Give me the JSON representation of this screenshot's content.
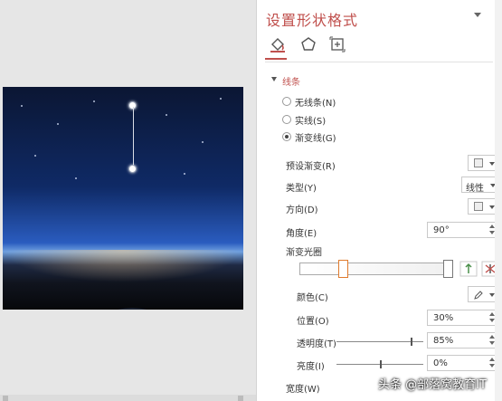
{
  "pane": {
    "title": "设置形状格式",
    "icons": [
      "fill-line-icon",
      "effects-pentagon-icon",
      "size-properties-icon"
    ]
  },
  "line_section": {
    "header": "线条",
    "options": [
      {
        "label": "无线条(N)",
        "selected": false
      },
      {
        "label": "实线(S)",
        "selected": false
      },
      {
        "label": "渐变线(G)",
        "selected": true
      }
    ]
  },
  "rows": {
    "preset_label": "预设渐变(R)",
    "type_label": "类型(Y)",
    "type_value": "线性",
    "direction_label": "方向(D)",
    "angle_label": "角度(E)",
    "angle_value": "90°",
    "stops_label": "渐变光圈",
    "color_label": "颜色(C)",
    "position_label": "位置(O)",
    "position_value": "30%",
    "transparency_label": "透明度(T)",
    "transparency_value": "85%",
    "brightness_label": "亮度(I)",
    "brightness_value": "0%",
    "width_label": "宽度(W)"
  },
  "gradient": {
    "stop_positions": [
      0.3,
      1.0
    ],
    "transparency_fraction": 0.85,
    "brightness_fraction": 0.5
  },
  "colors": {
    "accent": "#c0504d",
    "active_stop": "#e07a2c"
  },
  "watermark": "头条 @部落窝教育IT"
}
